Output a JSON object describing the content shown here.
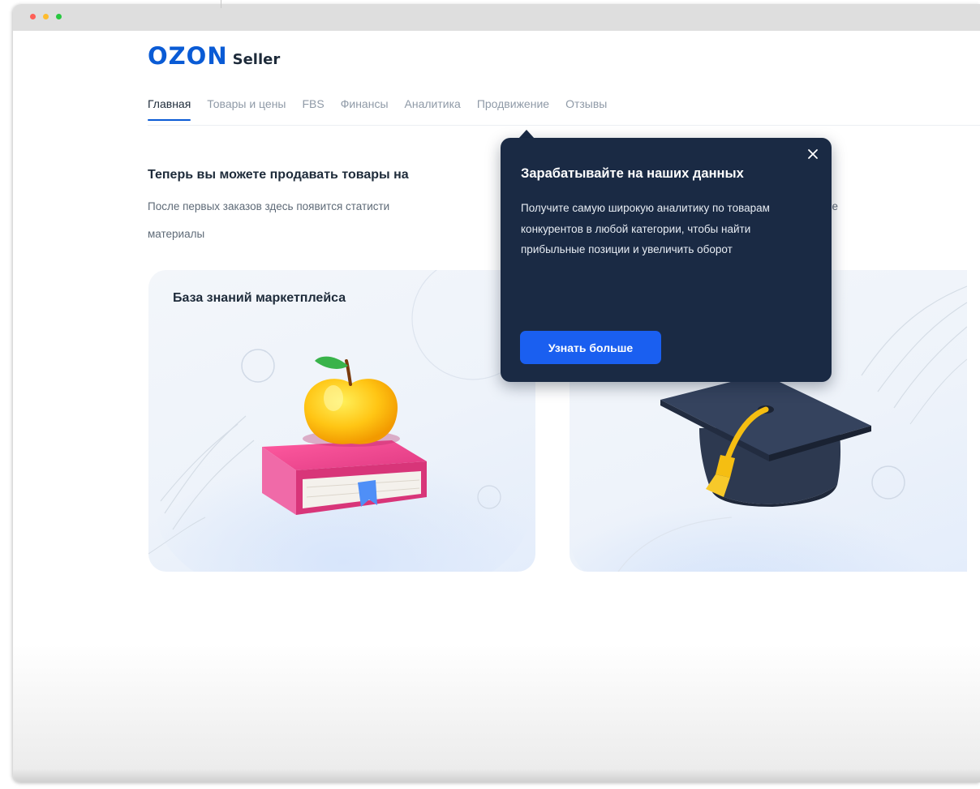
{
  "window": {
    "traffic_lights": [
      "close",
      "minimize",
      "zoom"
    ]
  },
  "header": {
    "logo_primary": "OZON",
    "logo_secondary": "Seller",
    "nav": [
      {
        "label": "Главная",
        "active": true
      },
      {
        "label": "Товары и цены",
        "active": false
      },
      {
        "label": "FBS",
        "active": false
      },
      {
        "label": "Финансы",
        "active": false
      },
      {
        "label": "Аналитика",
        "active": false
      },
      {
        "label": "Продвижение",
        "active": false
      },
      {
        "label": "Отзывы",
        "active": false
      }
    ]
  },
  "main": {
    "headline": "Теперь вы можете продавать товары на",
    "subtitle_line1": "После первых заказов здесь появится статисти",
    "subtitle_tail": "ие",
    "subtitle_line2": "материалы",
    "cards": [
      {
        "title": "База знаний маркетплейса",
        "icon": "apple-on-book-illustration"
      },
      {
        "title": "",
        "icon": "graduation-cap-illustration"
      }
    ]
  },
  "popover": {
    "title": "Зарабатывайте на наших данных",
    "text": "Получите самую широкую аналитику по товарам конкурентов в любой категории, чтобы найти прибыльные позиции и увеличить оборот",
    "button_label": "Узнать больше",
    "close_icon": "close-icon"
  },
  "colors": {
    "brand": "#0a5bd5",
    "popover_bg": "#1a2a44",
    "button_bg": "#1a5ff0",
    "text_primary": "#1e2b3a",
    "text_muted": "#8f9aa7"
  }
}
